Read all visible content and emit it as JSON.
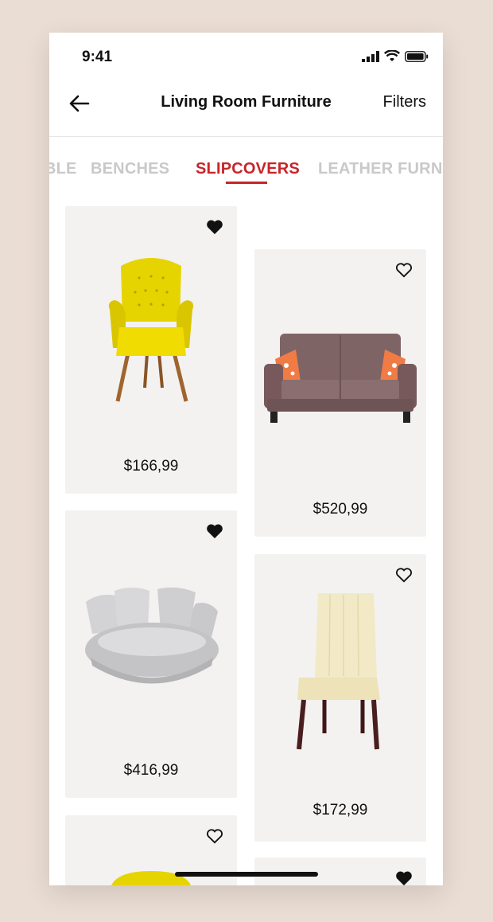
{
  "status_bar": {
    "time": "9:41"
  },
  "header": {
    "title": "Living Room Furniture",
    "filters_label": "Filters"
  },
  "tabs": [
    {
      "label": "BLE",
      "active": false
    },
    {
      "label": "BENCHES",
      "active": false
    },
    {
      "label": "SLIPCOVERS",
      "active": true
    },
    {
      "label": "LEATHER FURN",
      "active": false
    }
  ],
  "products": [
    {
      "name": "yellow-wingback-chair",
      "price": "$166,99",
      "favorited": true
    },
    {
      "name": "brown-loveseat",
      "price": "$520,99",
      "favorited": false
    },
    {
      "name": "grey-round-armchair",
      "price": "$416,99",
      "favorited": true
    },
    {
      "name": "cream-dining-chair",
      "price": "$172,99",
      "favorited": false
    },
    {
      "name": "yellow-item",
      "price": "",
      "favorited": false
    },
    {
      "name": "partial-item",
      "price": "",
      "favorited": true
    }
  ],
  "colors": {
    "accent": "#c8242a",
    "tab_inactive": "#c9c9c9",
    "card_bg": "#f3f2f1"
  }
}
